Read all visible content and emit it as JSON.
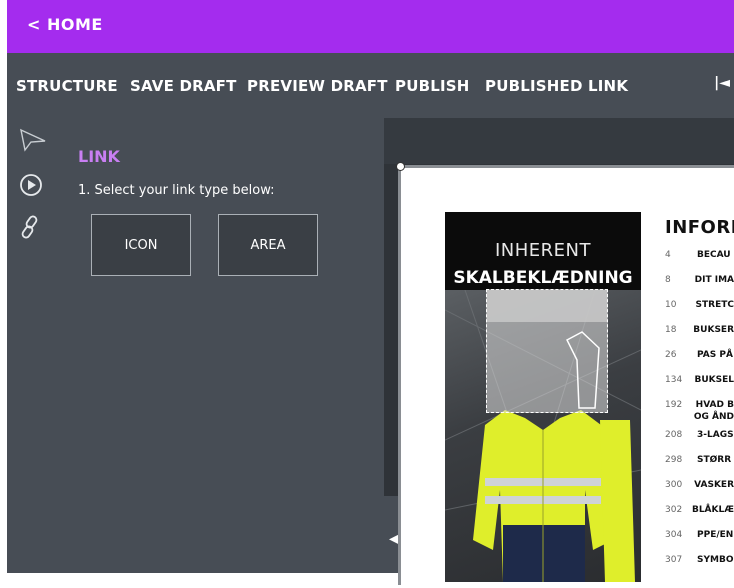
{
  "topbar": {
    "home_label": "< HOME"
  },
  "menu": {
    "items": [
      {
        "label": "STRUCTURE"
      },
      {
        "label": "SAVE DRAFT"
      },
      {
        "label": "PREVIEW DRAFT"
      },
      {
        "label": "PUBLISH"
      },
      {
        "label": "PUBLISHED LINK"
      }
    ],
    "first_page_icon": "|◄"
  },
  "tools": [
    "pointer-tool-icon",
    "play-tool-icon",
    "link-tool-icon"
  ],
  "panel": {
    "title": "LINK",
    "instruction": "1. Select your link type below:",
    "buttons": {
      "icon": "ICON",
      "area": "AREA"
    }
  },
  "collapse_arrow": "◀",
  "cover": {
    "line1": "INHERENT",
    "line2": "SKALBEKLÆDNING"
  },
  "toc": {
    "title": "INFORM",
    "rows": [
      {
        "num": "4",
        "text": "BECAU"
      },
      {
        "num": "8",
        "text": "DIT IMA"
      },
      {
        "num": "10",
        "text": "STRETC"
      },
      {
        "num": "18",
        "text": "BUKSER"
      },
      {
        "num": "26",
        "text": "PAS PÅ"
      },
      {
        "num": "134",
        "text": "BUKSEL"
      },
      {
        "num": "192",
        "text": "HVAD B"
      },
      {
        "num": "",
        "text": "OG ÅND"
      },
      {
        "num": "208",
        "text": "3-LAGS"
      },
      {
        "num": "298",
        "text": "STØRR"
      },
      {
        "num": "300",
        "text": "VASKER"
      },
      {
        "num": "302",
        "text": "BLÅKLÆ"
      },
      {
        "num": "304",
        "text": "PPE/EN"
      },
      {
        "num": "307",
        "text": "SYMBO"
      }
    ]
  }
}
